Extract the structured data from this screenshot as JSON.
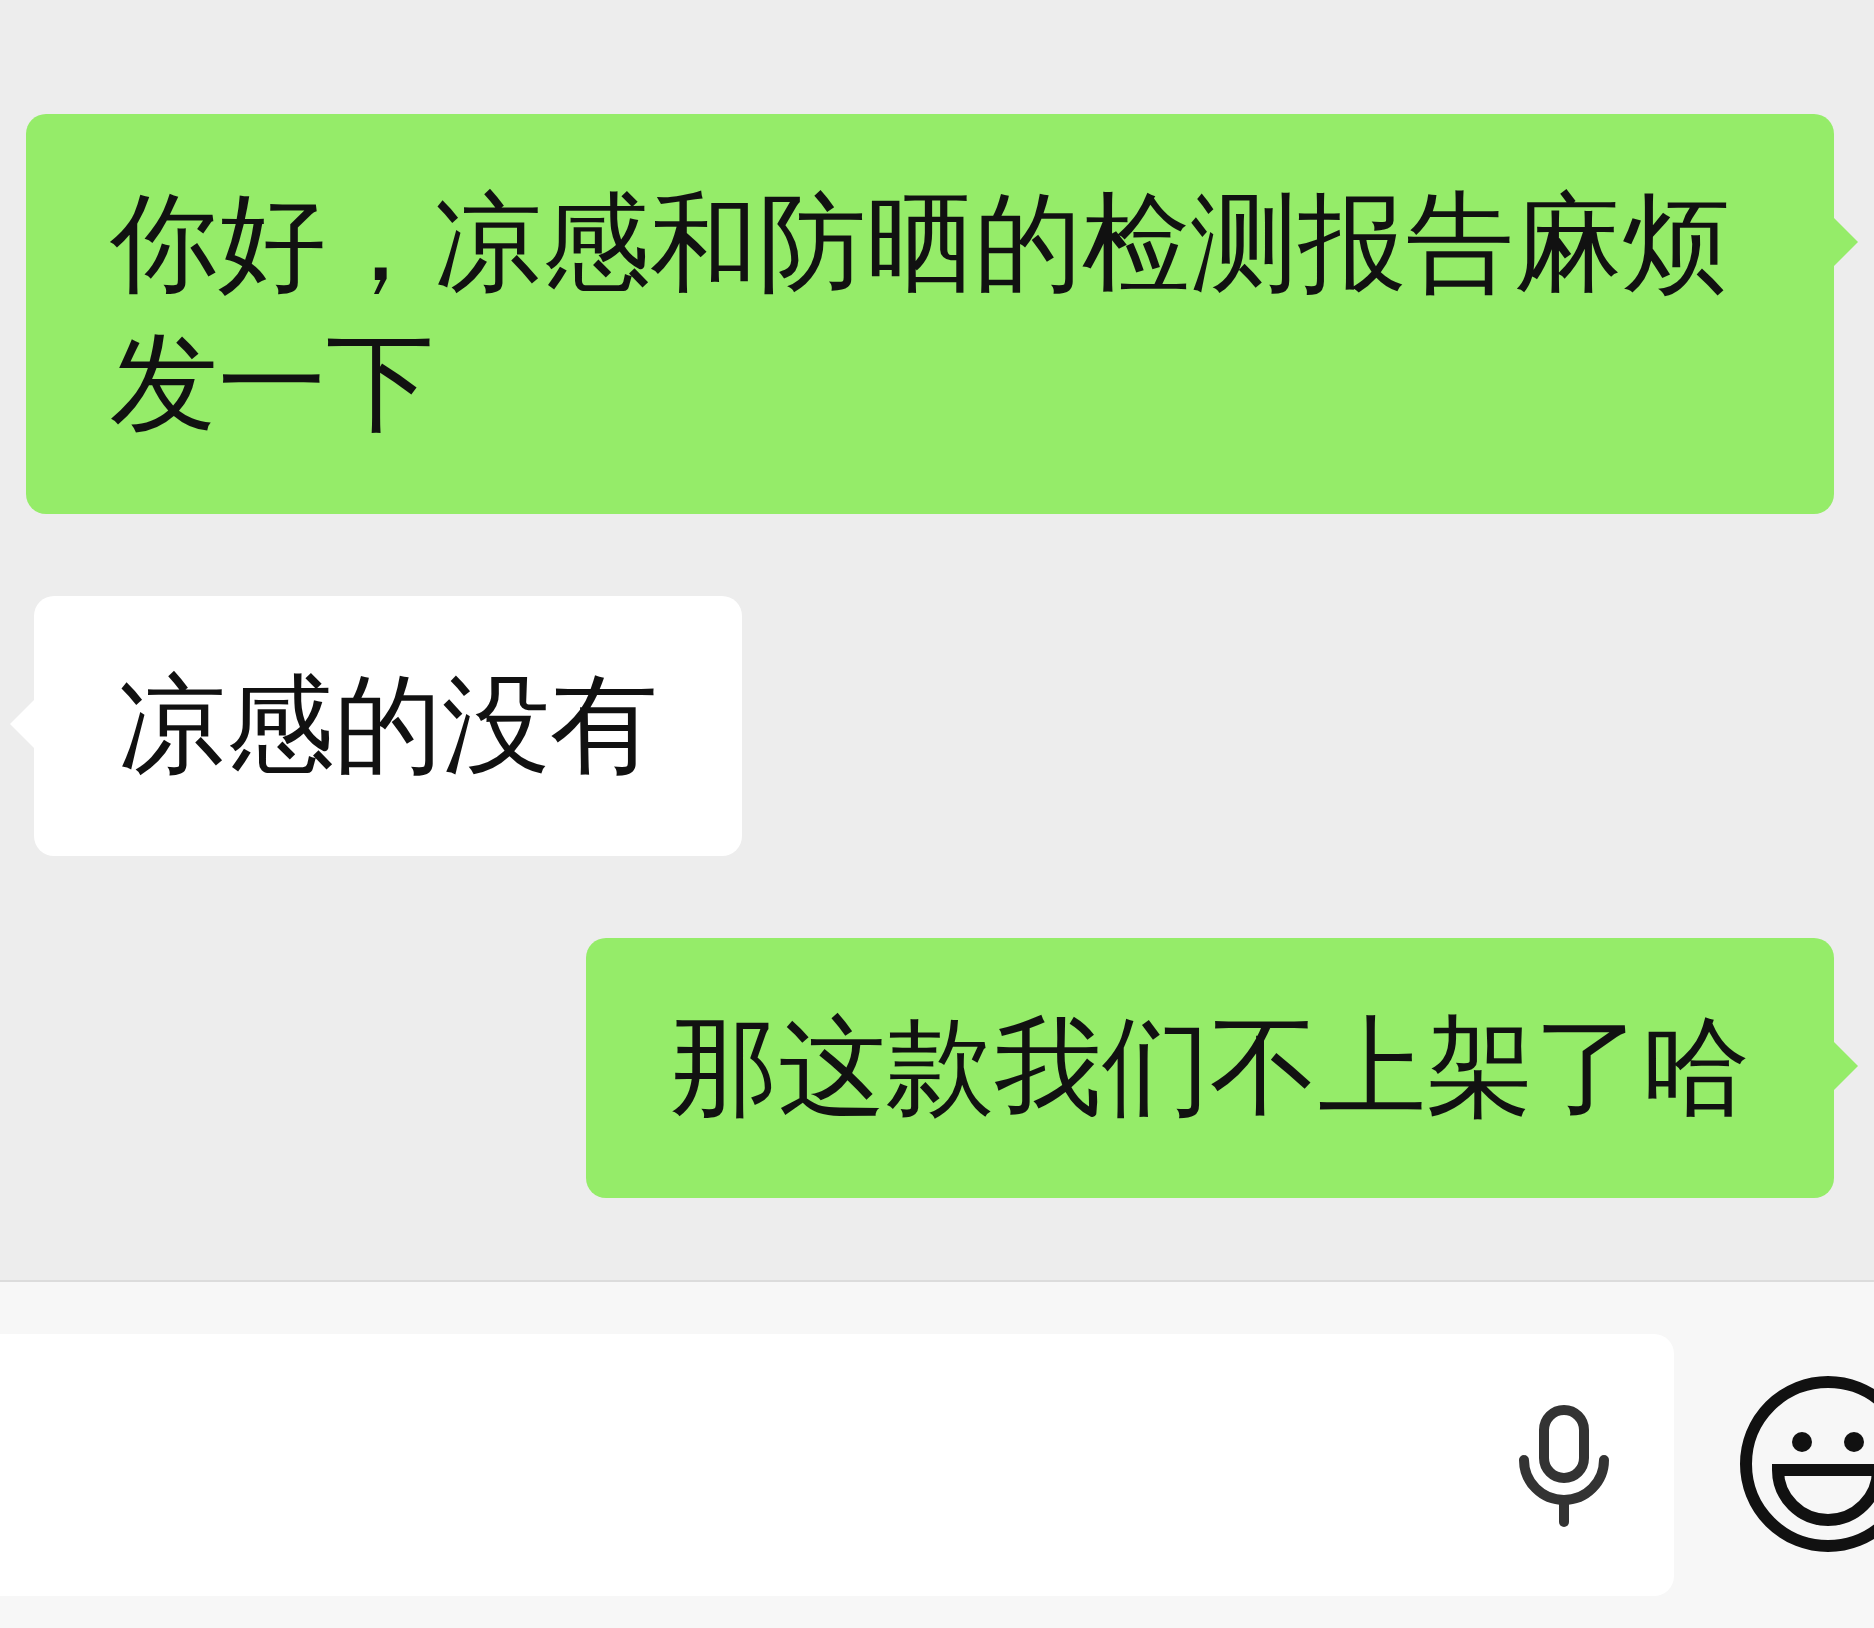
{
  "messages": [
    {
      "kind": "sent",
      "text": "你好，凉感和防晒的检测报告麻烦发一下"
    },
    {
      "kind": "received",
      "text": "凉感的没有"
    },
    {
      "kind": "sent",
      "text": "那这款我们不上架了哈"
    }
  ]
}
